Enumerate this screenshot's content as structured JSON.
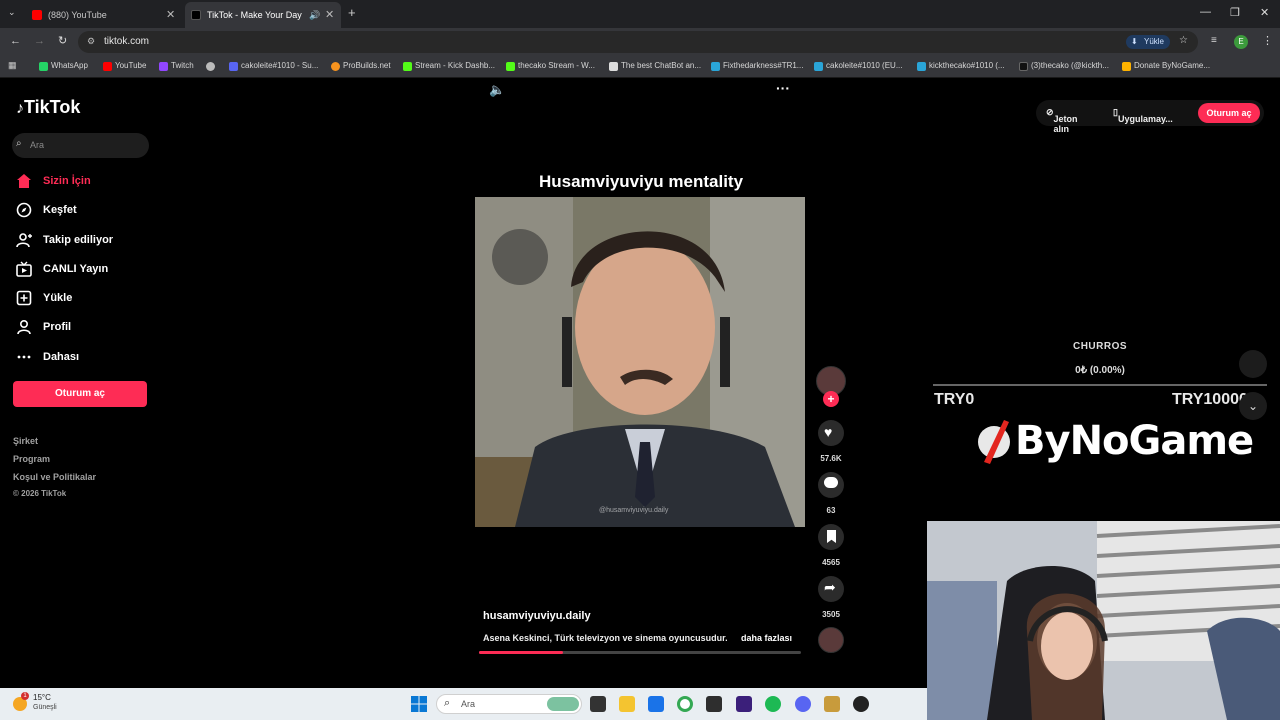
{
  "browser": {
    "tabs": [
      {
        "title": "(880) YouTube",
        "active": false
      },
      {
        "title": "TikTok - Make Your Day",
        "active": true
      }
    ],
    "url": "tiktok.com",
    "install_label": "Yükle",
    "profile_initial": "E",
    "bookmarks": [
      "WhatsApp",
      "YouTube",
      "Twitch",
      "",
      "cakoleite#1010 - Su...",
      "ProBuilds.net",
      "Stream - Kick Dashb...",
      "thecako Stream - W...",
      "The best ChatBot an...",
      "Fixthedarkness#TR1...",
      "cakoleite#1010 (EU...",
      "kickthecako#1010 (...",
      "(3)thecako (@kickth...",
      "Donate ByNoGame..."
    ]
  },
  "tiktok": {
    "logo": "TikTok",
    "search_placeholder": "Ara",
    "nav": [
      {
        "label": "Sizin İçin",
        "icon": "home-icon",
        "active": true
      },
      {
        "label": "Keşfet",
        "icon": "compass-icon",
        "active": false
      },
      {
        "label": "Takip ediliyor",
        "icon": "following-icon",
        "active": false
      },
      {
        "label": "CANLI Yayın",
        "icon": "live-tv-icon",
        "active": false
      },
      {
        "label": "Yükle",
        "icon": "upload-icon",
        "active": false
      },
      {
        "label": "Profil",
        "icon": "profile-icon",
        "active": false
      },
      {
        "label": "Dahası",
        "icon": "more-icon",
        "active": false
      }
    ],
    "login_label": "Oturum aç",
    "footer": [
      "Şirket",
      "Program",
      "Koşul ve Politikalar",
      "© 2026 TikTok"
    ],
    "top_right": {
      "coins": "Jeton alın",
      "app": "Uygulamay...",
      "login": "Oturum aç"
    },
    "video": {
      "title": "Husamviyuviyu mentality",
      "watermark": "@husamviyuviyu.daily",
      "author": "husamviyuviyu.daily",
      "description": "Asena Keskinci, Türk televizyon ve sinema oyuncusudur.",
      "more": "daha fazlası",
      "progress": 0.26
    },
    "actions": {
      "likes": "57.6K",
      "comments": "63",
      "saves": "4565",
      "shares": "3505"
    }
  },
  "overlay": {
    "goal_label": "CHURROS",
    "goal_value": "0₺ (0.00%)",
    "min": "TRY0",
    "max": "TRY100000",
    "brand": "ByNoGame"
  },
  "taskbar": {
    "temperature": "15°C",
    "condition": "Güneşli",
    "search_placeholder": "Ara"
  },
  "colors": {
    "accent": "#fe2c55",
    "background": "#000000"
  }
}
